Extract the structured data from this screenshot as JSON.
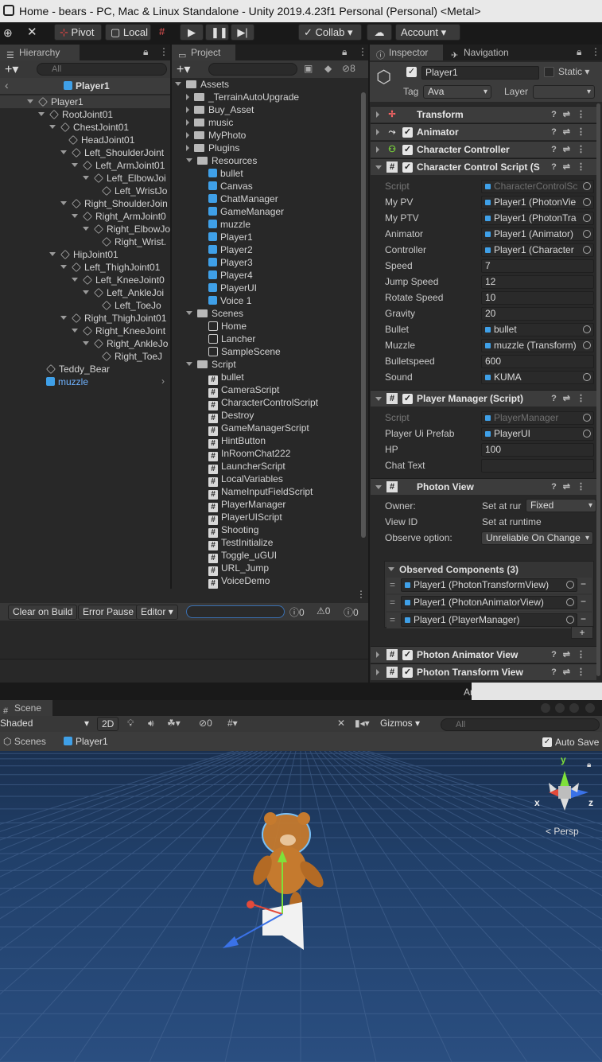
{
  "title": "Home - bears - PC, Mac & Linux Standalone - Unity 2019.4.23f1 Personal (Personal) <Metal>",
  "toolbar": {
    "pivot": "Pivot",
    "local": "Local",
    "collab": "Collab",
    "account": "Account"
  },
  "hierarchy": {
    "tab": "Hierarchy",
    "search_placeholder": "All",
    "scene_header": "Player1",
    "items": [
      {
        "label": "Player1",
        "depth": 0
      },
      {
        "label": "RootJoint01",
        "depth": 1
      },
      {
        "label": "ChestJoint01",
        "depth": 2
      },
      {
        "label": "HeadJoint01",
        "depth": 3
      },
      {
        "label": "Left_ShoulderJoint",
        "depth": 3
      },
      {
        "label": "Left_ArmJoint01",
        "depth": 4
      },
      {
        "label": "Left_ElbowJoi",
        "depth": 5
      },
      {
        "label": "Left_WristJo",
        "depth": 6
      },
      {
        "label": "Right_ShoulderJoin",
        "depth": 3
      },
      {
        "label": "Right_ArmJoint0",
        "depth": 4
      },
      {
        "label": "Right_ElbowJo",
        "depth": 5
      },
      {
        "label": "Right_Wrist.",
        "depth": 6
      },
      {
        "label": "HipJoint01",
        "depth": 2
      },
      {
        "label": "Left_ThighJoint01",
        "depth": 3
      },
      {
        "label": "Left_KneeJoint0",
        "depth": 4
      },
      {
        "label": "Left_AnkleJoi",
        "depth": 5
      },
      {
        "label": "Left_ToeJo",
        "depth": 6
      },
      {
        "label": "Right_ThighJoint01",
        "depth": 3
      },
      {
        "label": "Right_KneeJoint",
        "depth": 4
      },
      {
        "label": "Right_AnkleJo",
        "depth": 5
      },
      {
        "label": "Right_ToeJ",
        "depth": 6
      },
      {
        "label": "Teddy_Bear",
        "depth": 1
      },
      {
        "label": "muzzle",
        "depth": 1
      }
    ]
  },
  "project": {
    "tab": "Project",
    "hidden_count": "8",
    "items": [
      {
        "label": "Assets",
        "depth": 0,
        "kind": "folder"
      },
      {
        "label": "_TerrainAutoUpgrade",
        "depth": 1,
        "kind": "folder"
      },
      {
        "label": "Buy_Asset",
        "depth": 1,
        "kind": "folder"
      },
      {
        "label": "music",
        "depth": 1,
        "kind": "folder"
      },
      {
        "label": "MyPhoto",
        "depth": 1,
        "kind": "folder"
      },
      {
        "label": "Plugins",
        "depth": 1,
        "kind": "folder"
      },
      {
        "label": "Resources",
        "depth": 1,
        "kind": "folder"
      },
      {
        "label": "bullet",
        "depth": 2,
        "kind": "prefab"
      },
      {
        "label": "Canvas",
        "depth": 2,
        "kind": "prefab"
      },
      {
        "label": "ChatManager",
        "depth": 2,
        "kind": "prefab"
      },
      {
        "label": "GameManager",
        "depth": 2,
        "kind": "prefab"
      },
      {
        "label": "muzzle",
        "depth": 2,
        "kind": "prefab"
      },
      {
        "label": "Player1",
        "depth": 2,
        "kind": "prefab"
      },
      {
        "label": "Player2",
        "depth": 2,
        "kind": "prefab"
      },
      {
        "label": "Player3",
        "depth": 2,
        "kind": "prefab"
      },
      {
        "label": "Player4",
        "depth": 2,
        "kind": "prefab"
      },
      {
        "label": "PlayerUI",
        "depth": 2,
        "kind": "prefab"
      },
      {
        "label": "Voice 1",
        "depth": 2,
        "kind": "prefab"
      },
      {
        "label": "Scenes",
        "depth": 1,
        "kind": "folder"
      },
      {
        "label": "Home",
        "depth": 2,
        "kind": "scene"
      },
      {
        "label": "Lancher",
        "depth": 2,
        "kind": "scene"
      },
      {
        "label": "SampleScene",
        "depth": 2,
        "kind": "scene"
      },
      {
        "label": "Script",
        "depth": 1,
        "kind": "folder"
      },
      {
        "label": "bullet",
        "depth": 2,
        "kind": "script"
      },
      {
        "label": "CameraScript",
        "depth": 2,
        "kind": "script"
      },
      {
        "label": "CharacterControlScript",
        "depth": 2,
        "kind": "script"
      },
      {
        "label": "Destroy",
        "depth": 2,
        "kind": "script"
      },
      {
        "label": "GameManagerScript",
        "depth": 2,
        "kind": "script"
      },
      {
        "label": "HintButton",
        "depth": 2,
        "kind": "script"
      },
      {
        "label": "InRoomChat222",
        "depth": 2,
        "kind": "script"
      },
      {
        "label": "LauncherScript",
        "depth": 2,
        "kind": "script"
      },
      {
        "label": "LocalVariables",
        "depth": 2,
        "kind": "script"
      },
      {
        "label": "NameInputFieldScript",
        "depth": 2,
        "kind": "script"
      },
      {
        "label": "PlayerManager",
        "depth": 2,
        "kind": "script"
      },
      {
        "label": "PlayerUIScript",
        "depth": 2,
        "kind": "script"
      },
      {
        "label": "Shooting",
        "depth": 2,
        "kind": "script"
      },
      {
        "label": "TestInitialize",
        "depth": 2,
        "kind": "script"
      },
      {
        "label": "Toggle_uGUI",
        "depth": 2,
        "kind": "script"
      },
      {
        "label": "URL_Jump",
        "depth": 2,
        "kind": "script"
      },
      {
        "label": "VoiceDemo",
        "depth": 2,
        "kind": "script"
      }
    ]
  },
  "console": {
    "clear_on_build": "Clear on Build",
    "error_pause": "Error Pause",
    "editor": "Editor",
    "count_info": "0",
    "count_warn": "0",
    "count_error": "0"
  },
  "inspector": {
    "tab": "Inspector",
    "nav_tab": "Navigation",
    "object_name": "Player1",
    "static_label": "Static",
    "tag_label": "Tag",
    "tag_value": "Ava",
    "layer_label": "Layer",
    "layer_value": "",
    "components": {
      "transform": "Transform",
      "animator": "Animator",
      "character_controller": "Character Controller",
      "ccs": "Character Control Script (S",
      "player_manager": "Player Manager (Script)",
      "photon_view": "Photon View",
      "photon_animator_view": "Photon Animator View",
      "photon_transform_view": "Photon Transform View"
    },
    "ccs_props": [
      {
        "label": "Script",
        "value": "CharacterControlSc",
        "dim": true,
        "obj": true
      },
      {
        "label": "My PV",
        "value": "Player1 (PhotonVie",
        "obj": true
      },
      {
        "label": "My PTV",
        "value": "Player1 (PhotonTra",
        "obj": true
      },
      {
        "label": "Animator",
        "value": "Player1 (Animator)",
        "obj": true
      },
      {
        "label": "Controller",
        "value": "Player1 (Character",
        "obj": true
      },
      {
        "label": "Speed",
        "value": "7"
      },
      {
        "label": "Jump Speed",
        "value": "12"
      },
      {
        "label": "Rotate Speed",
        "value": "10"
      },
      {
        "label": "Gravity",
        "value": "20"
      },
      {
        "label": "Bullet",
        "value": "bullet",
        "obj": true
      },
      {
        "label": "Muzzle",
        "value": "muzzle (Transform)",
        "obj": true
      },
      {
        "label": "Bulletspeed",
        "value": "600"
      },
      {
        "label": "Sound",
        "value": "KUMA",
        "obj": true
      }
    ],
    "pm_props": [
      {
        "label": "Script",
        "value": "PlayerManager",
        "dim": true,
        "obj": true
      },
      {
        "label": "Player Ui Prefab",
        "value": "PlayerUI",
        "obj": true
      },
      {
        "label": "HP",
        "value": "100"
      },
      {
        "label": "Chat Text",
        "value": ""
      }
    ],
    "photon": {
      "owner_label": "Owner:",
      "owner_value": "Set at rur",
      "owner_mode": "Fixed",
      "viewid_label": "View ID",
      "viewid_value": "Set at runtime",
      "observe_label": "Observe option:",
      "observe_value": "Unreliable On Change",
      "observed_header": "Observed Components (3)",
      "observed": [
        "Player1 (PhotonTransformView)",
        "Player1 (PhotonAnimatorView)",
        "Player1 (PlayerManager)"
      ]
    }
  },
  "scene_view": {
    "tab": "Scene",
    "shading": "Shaded",
    "twod": "2D",
    "fx_count": "0",
    "gizmos": "Gizmos",
    "search_placeholder": "All",
    "breadcrumb_root": "Scenes",
    "breadcrumb_item": "Player1",
    "auto_save": "Auto Save",
    "persp": "Persp",
    "axis_x": "x",
    "axis_y": "y",
    "axis_z": "z",
    "status_text": "Ar"
  }
}
